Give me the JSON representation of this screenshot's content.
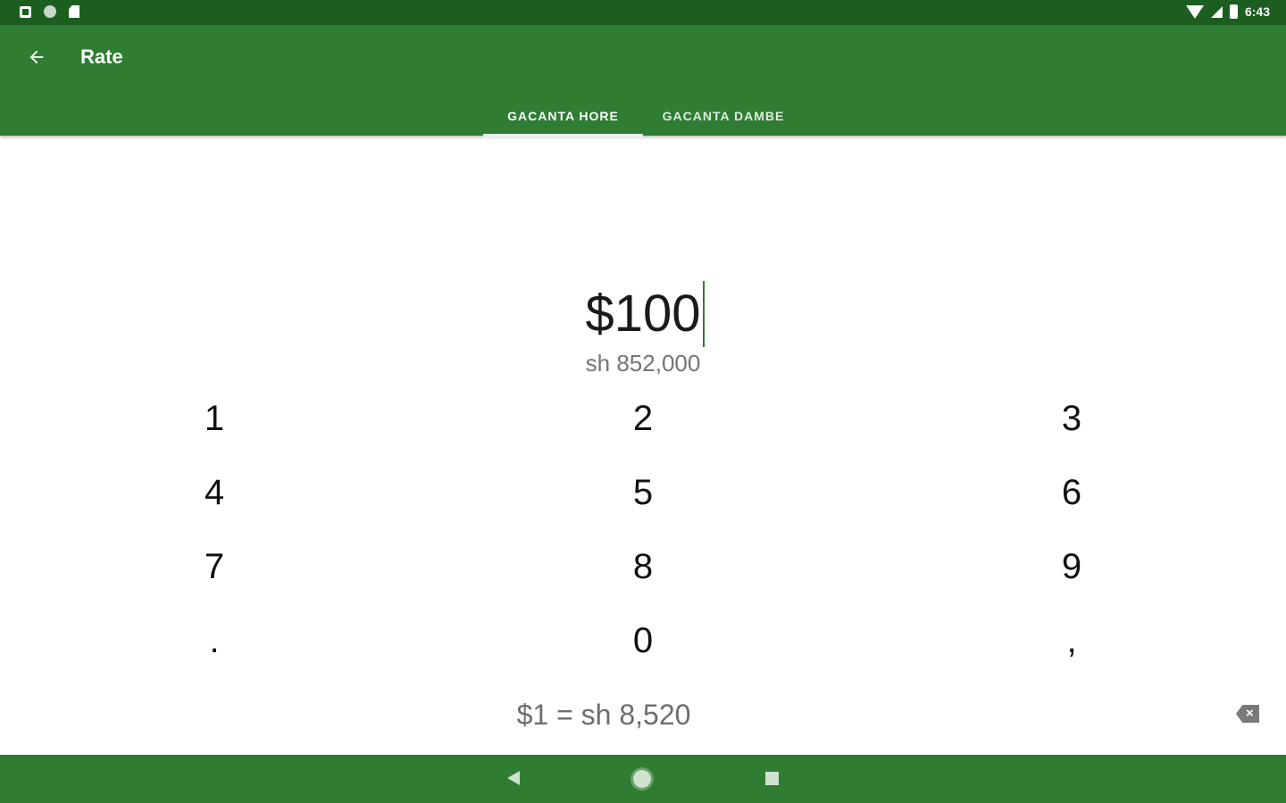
{
  "status_bar": {
    "time": "6:43"
  },
  "app_bar": {
    "title": "Rate",
    "back_icon": "arrow-left-icon"
  },
  "tabs": [
    {
      "label": "GACANTA HORE",
      "selected": true
    },
    {
      "label": "GACANTA DAMBE",
      "selected": false
    }
  ],
  "amount": {
    "value": "$100",
    "converted": "sh 852,000"
  },
  "keypad": {
    "rows": [
      [
        "1",
        "2",
        "3"
      ],
      [
        "4",
        "5",
        "6"
      ],
      [
        "7",
        "8",
        "9"
      ],
      [
        ".",
        "0",
        ","
      ]
    ]
  },
  "rate_line": "$1 = sh 8,520",
  "colors": {
    "primary": "#2e7d32",
    "primary_dark": "#1b5e20",
    "accent_cursor": "#2e7d32"
  }
}
